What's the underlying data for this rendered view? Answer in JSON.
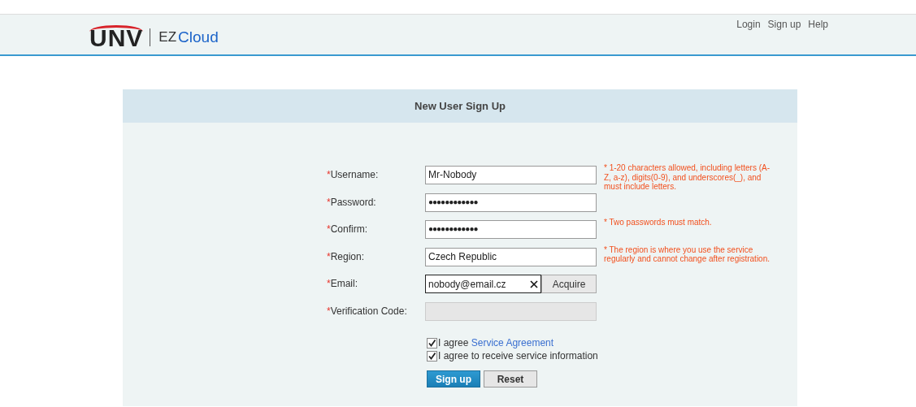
{
  "header": {
    "logo": {
      "brand": "UNV",
      "product_prefix": "EZ",
      "product": "Cloud"
    },
    "links": [
      {
        "label": "Login"
      },
      {
        "label": "Sign up"
      },
      {
        "label": "Help"
      }
    ]
  },
  "form": {
    "title": "New User Sign Up",
    "fields": [
      {
        "kind": "text",
        "label": "Username:",
        "required_mark": "*",
        "value": "Mr-Nobody",
        "hint": "* 1-20 characters allowed, including letters (A-Z, a-z), digits(0-9), and underscores(_), and must include letters."
      },
      {
        "kind": "password",
        "label": "Password:",
        "required_mark": "*",
        "value": "●●●●●●●●●●●●"
      },
      {
        "kind": "password",
        "label": "Confirm:",
        "required_mark": "*",
        "value": "●●●●●●●●●●●●",
        "hint": "* Two passwords must match."
      },
      {
        "kind": "text",
        "label": "Region:",
        "required_mark": "*",
        "value": "Czech Republic",
        "hint": "* The region is where you use the service regularly and cannot change after registration."
      },
      {
        "kind": "email",
        "label": "Email:",
        "required_mark": "*",
        "value": "nobody@email.cz",
        "button": "Acquire"
      },
      {
        "kind": "disabled",
        "label": "Verification Code:",
        "required_mark": "*"
      }
    ],
    "agreements": [
      {
        "text": "I agree ",
        "link": "Service Agreement",
        "checked": true
      },
      {
        "text": "I agree to receive service information",
        "checked": true
      }
    ],
    "buttons": [
      {
        "kind": "primary",
        "label": "Sign up"
      },
      {
        "kind": "secondary",
        "label": "Reset"
      }
    ]
  }
}
